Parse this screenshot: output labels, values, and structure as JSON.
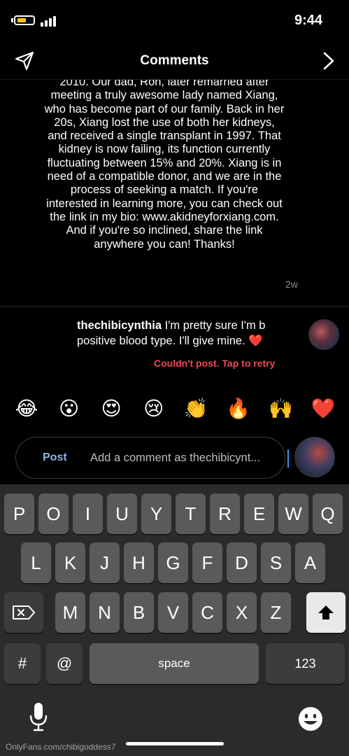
{
  "status_bar": {
    "time": "9:44"
  },
  "header": {
    "title": "Comments"
  },
  "comment": {
    "lines": [
      "2010. Our dad, Ron, later remarried after",
      "meeting a truly awesome lady named Xiang,",
      "who has become part of our family. Back in her",
      "20s, Xiang lost the use of both her kidneys,",
      "and received a single transplant in 1997. That",
      "kidney is now failing, its function currently",
      "fluctuating between 15% and 20%. Xiang is in",
      "need of a compatible donor, and we are in the",
      "process of seeking a match. If you're",
      "interested in learning more, you can check out",
      "the link in my bio: www.akidneyforxiang.com.",
      "And if you're so inclined, share the link",
      "anywhere you can! Thanks!"
    ],
    "age": "2w"
  },
  "failed_comment": {
    "username": "thechibicynthia",
    "text": "I'm pretty sure I'm b positive blood type. I'll give mine. ❤️",
    "status": "Couldn't post. Tap to retry"
  },
  "emoji_bar": [
    "😂",
    "😮",
    "😍",
    "😢",
    "👏",
    "🔥",
    "🙌",
    "❤️"
  ],
  "input": {
    "placeholder": "Add a comment as thechibicynt...",
    "post_label": "Post"
  },
  "keyboard": {
    "row1": [
      "Q",
      "W",
      "E",
      "R",
      "T",
      "Y",
      "U",
      "I",
      "O",
      "P"
    ],
    "row2": [
      "A",
      "S",
      "D",
      "F",
      "G",
      "H",
      "J",
      "K",
      "L"
    ],
    "row3": [
      "Z",
      "X",
      "C",
      "V",
      "B",
      "N",
      "M"
    ],
    "numbers_label": "123",
    "space_label": "space",
    "at_label": "@",
    "hash_label": "#"
  },
  "watermark": "OnlyFans.com/chibigoddess7"
}
